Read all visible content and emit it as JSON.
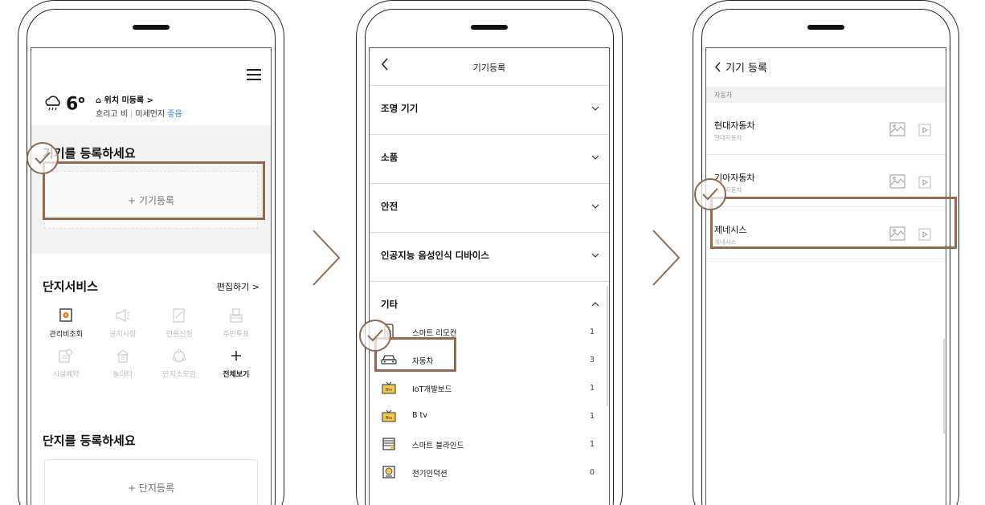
{
  "screen1": {
    "temperature": "6",
    "location_label": "⌂ 위치 미등록 >",
    "weather_condition": "흐리고 비",
    "dust_label": "미세먼지",
    "dust_value": "좋음",
    "device_section_title": "기기를 등록하세요",
    "add_device_label": "+ 기기등록",
    "service_title": "단지서비스",
    "service_edit": "편집하기 >",
    "services": [
      {
        "label": "관리비조회",
        "icon": "bill-icon",
        "active": true
      },
      {
        "label": "공지사항",
        "icon": "megaphone-icon",
        "active": false
      },
      {
        "label": "민원신청",
        "icon": "edit-document-icon",
        "active": false
      },
      {
        "label": "주민투표",
        "icon": "ballot-box-icon",
        "active": false
      },
      {
        "label": "시설예약",
        "icon": "facility-calendar-icon",
        "active": false
      },
      {
        "label": "놀이터",
        "icon": "playground-icon",
        "active": false
      },
      {
        "label": "단지소모임",
        "icon": "community-icon",
        "active": false
      },
      {
        "label": "전체보기",
        "icon": "plus-icon",
        "active": true
      }
    ],
    "complex_title": "단지를 등록하세요",
    "add_complex_label": "+ 단지등록"
  },
  "screen2": {
    "title": "기기등록",
    "categories": [
      {
        "label": "조명 기기",
        "expanded": false
      },
      {
        "label": "소품",
        "expanded": false
      },
      {
        "label": "안전",
        "expanded": false
      },
      {
        "label": "인공지능 음성인식 디바이스",
        "expanded": false
      },
      {
        "label": "기타",
        "expanded": true
      }
    ],
    "items": [
      {
        "name": "스마트 리모컨",
        "count": "1",
        "icon": "remote-control-icon"
      },
      {
        "name": "자동차",
        "count": "3",
        "icon": "car-icon"
      },
      {
        "name": "IoT개발보드",
        "count": "1",
        "icon": "btv-iot-board-icon"
      },
      {
        "name": "B tv",
        "count": "1",
        "icon": "btv-icon"
      },
      {
        "name": "스마트 블라인드",
        "count": "1",
        "icon": "blind-icon"
      },
      {
        "name": "전기인덕션",
        "count": "0",
        "icon": "induction-icon"
      }
    ]
  },
  "screen3": {
    "title": "기기 등록",
    "section": "자동차",
    "items": [
      {
        "name": "현대자동차",
        "sub": "현대자동차"
      },
      {
        "name": "기아자동차",
        "sub": "기아자동차"
      },
      {
        "name": "제네시스",
        "sub": "제네시스"
      }
    ]
  },
  "colors": {
    "highlight": "#96694f",
    "dust_good": "#3a8fe0",
    "bill_icon": "#e07a1c"
  }
}
